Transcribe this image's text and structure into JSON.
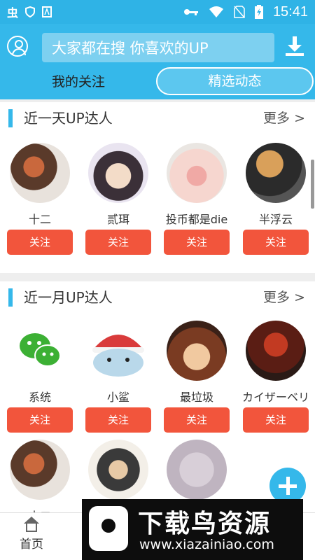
{
  "status_bar": {
    "time": "15:41",
    "app_glyph": "虫"
  },
  "header": {
    "search_placeholder": "大家都在搜 你喜欢的UP",
    "tabs": [
      {
        "label": "我的关注"
      },
      {
        "label": "精选动态"
      }
    ]
  },
  "sections": [
    {
      "title": "近一天UP达人",
      "more": "更多 >",
      "users": [
        {
          "name": "十二",
          "follow": "关注"
        },
        {
          "name": "贰珥",
          "follow": "关注"
        },
        {
          "name": "投币都是die",
          "follow": "关注"
        },
        {
          "name": "半浮云",
          "follow": "关注"
        }
      ]
    },
    {
      "title": "近一月UP达人",
      "more": "更多 >",
      "users": [
        {
          "name": "系统",
          "follow": "关注"
        },
        {
          "name": "小鲨",
          "follow": "关注"
        },
        {
          "name": "最垃圾",
          "follow": "关注"
        },
        {
          "name": "カイザーベリ",
          "follow": "关注"
        }
      ],
      "users_row2_partial": [
        {
          "name": "十二"
        },
        {
          "name": ""
        },
        {
          "name": ""
        }
      ]
    }
  ],
  "bottom_nav": {
    "home": "首页"
  },
  "watermark": {
    "title": "下载鸟资源",
    "url": "www.xiazainiao.com"
  },
  "colors": {
    "primary": "#35b8ea",
    "follow_button": "#f2553c"
  }
}
